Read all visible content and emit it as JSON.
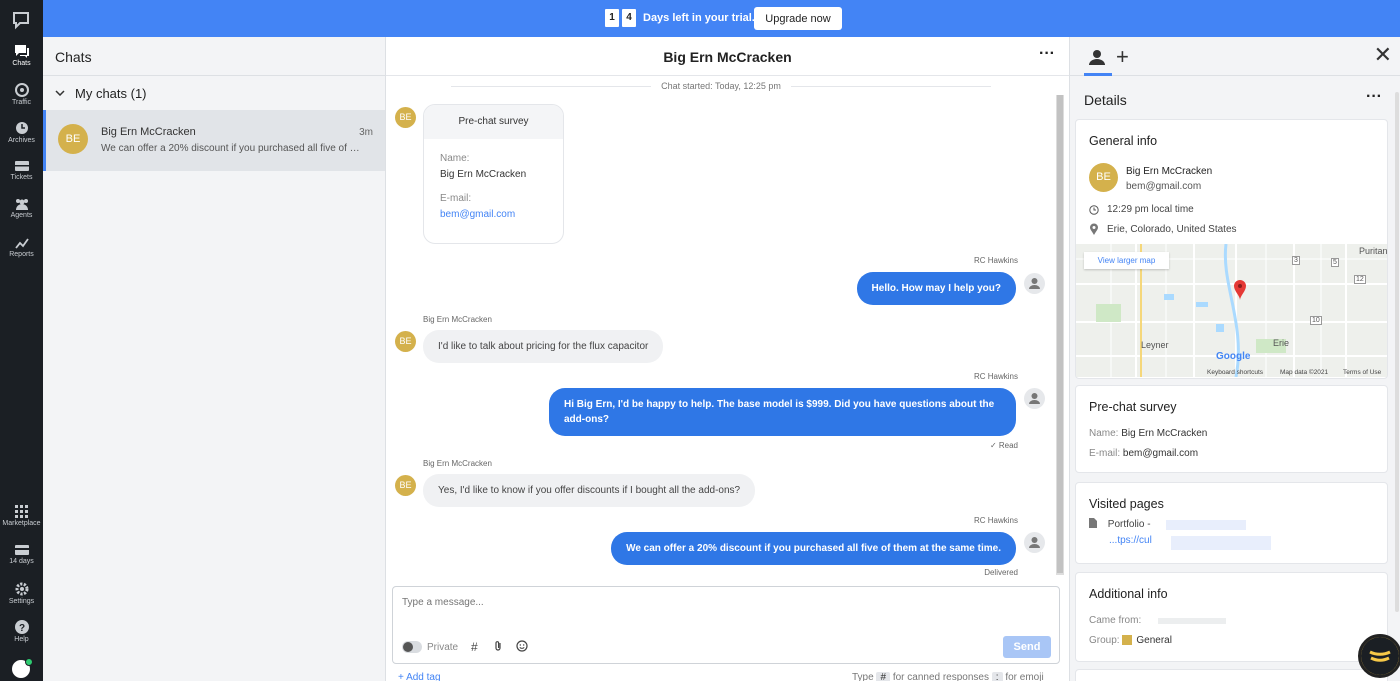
{
  "banner": {
    "digits": [
      "1",
      "4"
    ],
    "text": "Days left in your trial.",
    "upgrade_label": "Upgrade now"
  },
  "nav": {
    "items": [
      {
        "label": "Chats",
        "icon": "chat-icon"
      },
      {
        "label": "Traffic",
        "icon": "traffic-icon"
      },
      {
        "label": "Archives",
        "icon": "clock-icon"
      },
      {
        "label": "Tickets",
        "icon": "ticket-icon"
      },
      {
        "label": "Agents",
        "icon": "agents-icon"
      },
      {
        "label": "Reports",
        "icon": "chart-line-icon"
      },
      {
        "label": "Marketplace",
        "icon": "grid-icon"
      },
      {
        "label": "14 days",
        "icon": "card-icon"
      },
      {
        "label": "Settings",
        "icon": "gear-icon"
      },
      {
        "label": "Help",
        "icon": "help-icon"
      }
    ]
  },
  "chat_list": {
    "title": "Chats",
    "section_label": "My chats (1)",
    "items": [
      {
        "initials": "BE",
        "name": "Big Ern McCracken",
        "time": "3m",
        "preview": "We can offer a 20% discount if you purchased all five of them at the same time."
      }
    ]
  },
  "conversation": {
    "title": "Big Ern McCracken",
    "started": "Chat started: Today, 12:25 pm",
    "visitor_initials": "BE",
    "survey": {
      "title": "Pre-chat survey",
      "name_label": "Name:",
      "name_value": "Big Ern McCracken",
      "email_label": "E-mail:",
      "email_value": "bem@gmail.com"
    },
    "messages": [
      {
        "sender": "RC Hawkins",
        "text": "Hello. How may I help you?",
        "status": ""
      },
      {
        "sender": "Big Ern McCracken",
        "text": "I'd like to talk about pricing for the flux capacitor",
        "status": ""
      },
      {
        "sender": "RC Hawkins",
        "text": "Hi Big Ern, I'd be happy to help. The base model is $999. Did you have questions about the add-ons?",
        "status": "✓ Read"
      },
      {
        "sender": "Big Ern McCracken",
        "text": "Yes, I'd like to know if you offer discounts if I bought all the add-ons?",
        "status": ""
      },
      {
        "sender": "RC Hawkins",
        "text": "We can offer a 20% discount if you purchased all five of them at the same time.",
        "status": "Delivered"
      }
    ],
    "composer": {
      "placeholder": "Type a message...",
      "private_label": "Private",
      "send_label": "Send",
      "add_tag": "+ Add tag",
      "hint_type": "Type",
      "hint_hash": "#",
      "hint_canned": "for canned responses",
      "hint_colon": ":",
      "hint_emoji": "for emoji"
    }
  },
  "details": {
    "title": "Details",
    "general": {
      "title": "General info",
      "initials": "BE",
      "name": "Big Ern McCracken",
      "email": "bem@gmail.com",
      "local_time": "12:29 pm local time",
      "location": "Erie, Colorado, United States"
    },
    "map": {
      "view_larger": "View larger map",
      "labels": [
        "Puritan",
        "Leyner",
        "Erie",
        "3",
        "5",
        "12",
        "10",
        "Google"
      ],
      "footer_shortcuts": "Keyboard shortcuts",
      "footer_data": "Map data ©2021",
      "footer_terms": "Terms of Use"
    },
    "survey": {
      "title": "Pre-chat survey",
      "name_label": "Name:",
      "name_value": "Big Ern McCracken",
      "email_label": "E-mail:",
      "email_value": "bem@gmail.com"
    },
    "visited": {
      "title": "Visited pages",
      "page_title": "Portfolio -",
      "page_url": "...tps://cul"
    },
    "additional": {
      "title": "Additional info",
      "came_from_label": "Came from:",
      "group_label": "Group:",
      "group_value": "General"
    }
  },
  "colors": {
    "accent": "#4384f5",
    "bubble_out": "#2f77e6",
    "avatar": "#d4b14c",
    "rail": "#1b1f24"
  }
}
